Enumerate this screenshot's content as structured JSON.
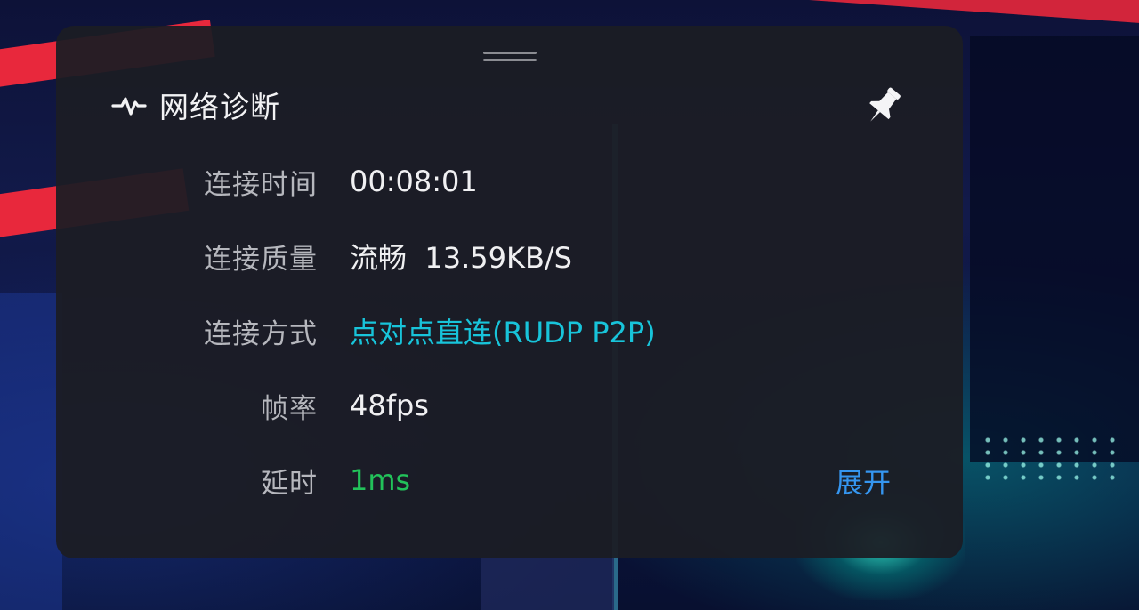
{
  "panel": {
    "title": "网络诊断",
    "title_icon": "pulse-icon",
    "pin_icon": "pin-icon",
    "drag_handle_icon": "drag-handle-icon"
  },
  "rows": [
    {
      "label": "连接时间",
      "value": "00:08:01"
    },
    {
      "label": "连接质量",
      "value": "流畅  13.59KB/S"
    },
    {
      "label": "连接方式",
      "value": "点对点直连(RUDP P2P)"
    },
    {
      "label": "帧率",
      "value": "48fps"
    },
    {
      "label": "延时",
      "value": "1ms"
    }
  ],
  "expand_label": "展开",
  "colors": {
    "panel_bg": "#1c1d24",
    "label": "#b6b7bd",
    "value": "#f0f0f2",
    "connection_mode": "#18c4da",
    "latency_good": "#22c25a",
    "link": "#3596f0"
  }
}
